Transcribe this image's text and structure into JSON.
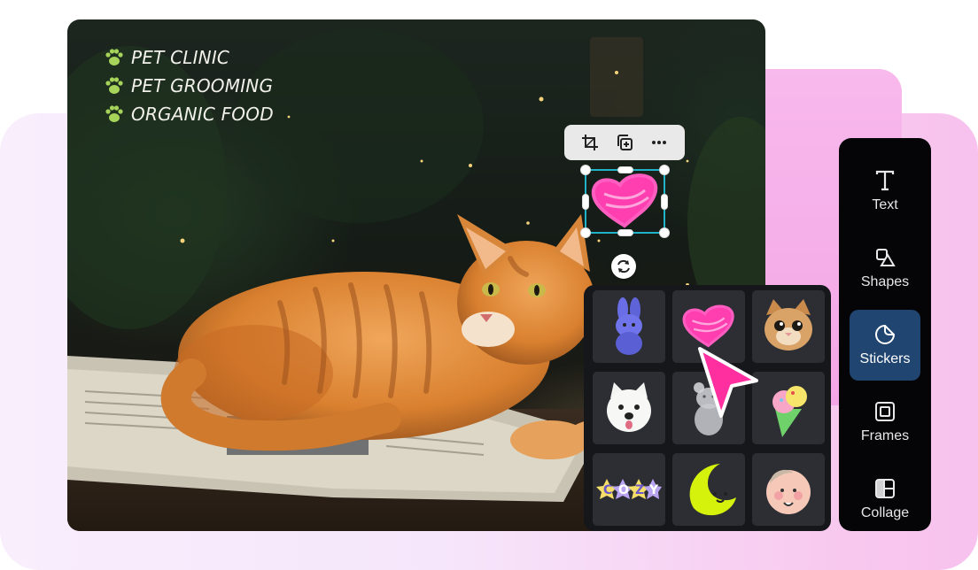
{
  "canvas": {
    "tags": [
      {
        "text": "PET CLINIC",
        "icon": "paw-icon"
      },
      {
        "text": "PET GROOMING",
        "icon": "paw-icon"
      },
      {
        "text": "ORGANIC FOOD",
        "icon": "paw-icon"
      }
    ],
    "tag_color": "#f1f1ea",
    "paw_color": "#a6d35a"
  },
  "selection_toolbar": {
    "buttons": [
      "crop-icon",
      "duplicate-icon",
      "more-icon"
    ]
  },
  "selected_sticker": "pink-heart-sticker",
  "stickers": [
    "purple-bunny-sticker",
    "pink-heart-sticker",
    "cat-face-sticker",
    "white-dog-sticker",
    "gummy-bear-sticker",
    "ice-cream-sticker",
    "cozy-text-sticker",
    "smiling-moon-sticker",
    "blushing-face-sticker"
  ],
  "tools": [
    {
      "label": "Text",
      "icon": "text-icon",
      "active": false
    },
    {
      "label": "Shapes",
      "icon": "shapes-icon",
      "active": false
    },
    {
      "label": "Stickers",
      "icon": "sticker-icon",
      "active": true
    },
    {
      "label": "Frames",
      "icon": "frame-icon",
      "active": false
    },
    {
      "label": "Collage",
      "icon": "collage-icon",
      "active": false
    }
  ],
  "colors": {
    "accent_active": "#1f4570",
    "selection_border": "#21b4c8",
    "cursor": "#ff2fa0",
    "heart": "#ff3fb0"
  }
}
